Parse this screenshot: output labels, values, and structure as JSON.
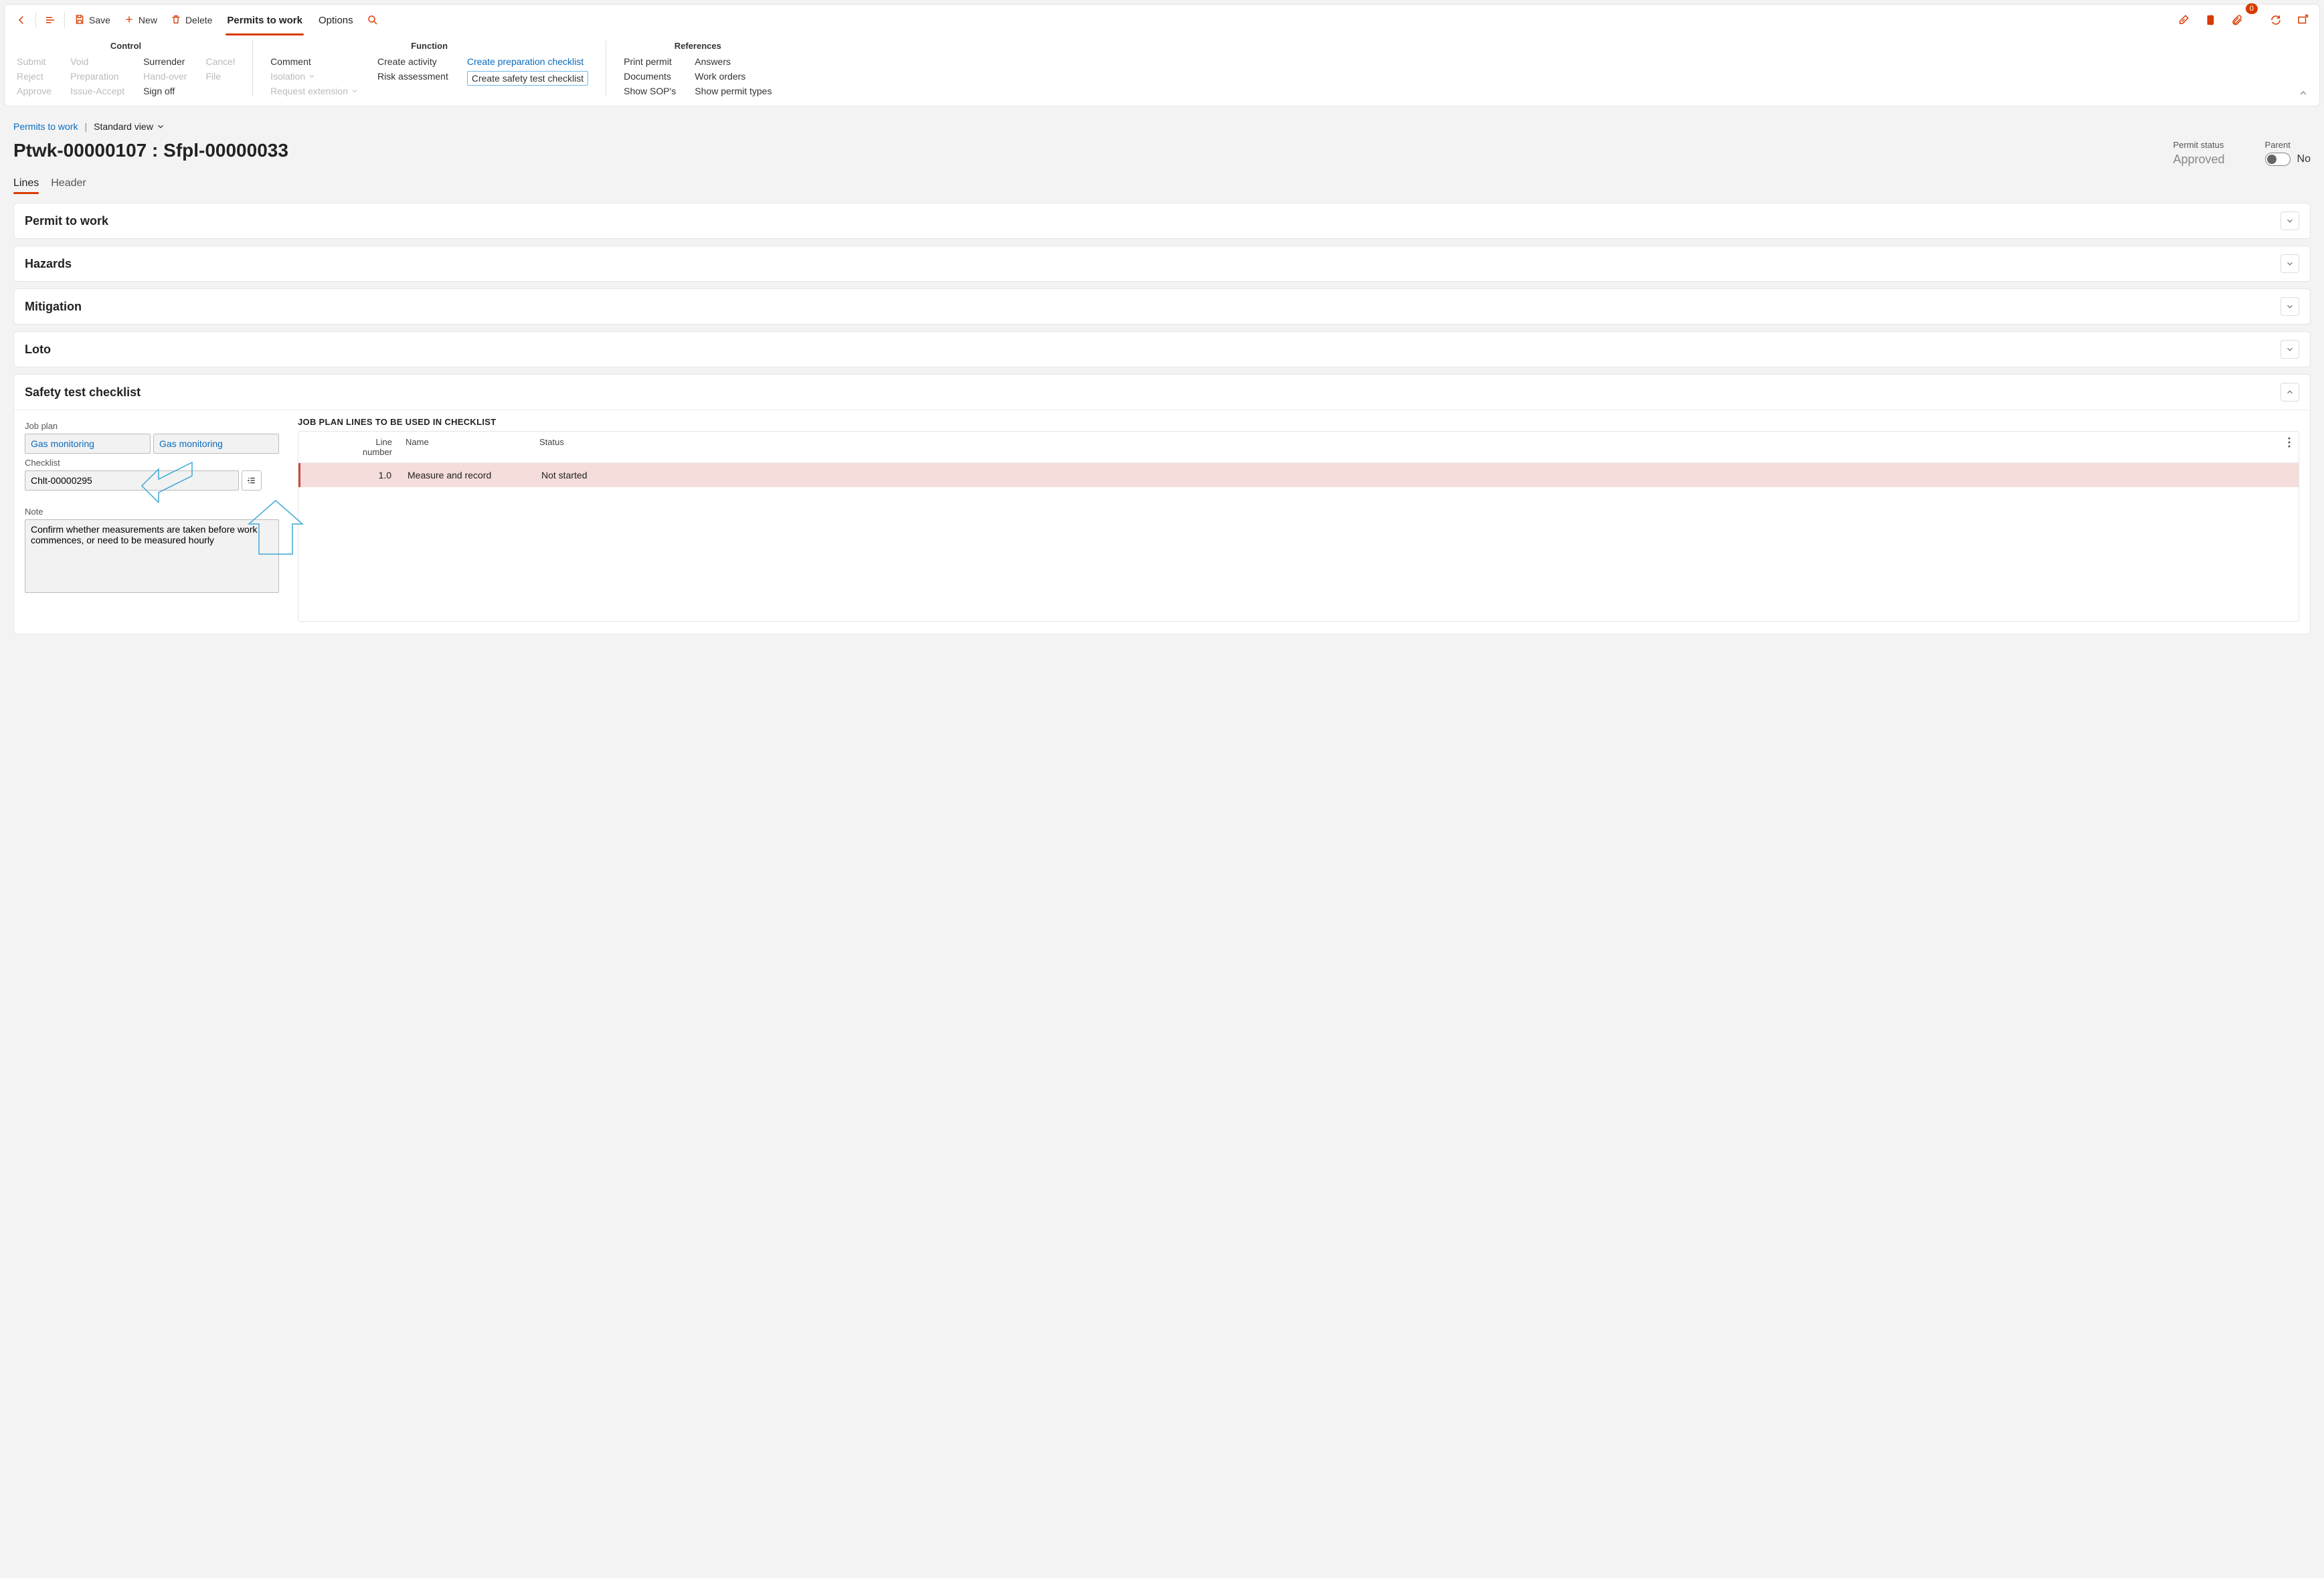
{
  "toolbar": {
    "save": "Save",
    "new": "New",
    "delete": "Delete",
    "tabs": {
      "permits": "Permits to work",
      "options": "Options"
    },
    "attachments_badge": "0"
  },
  "ribbon": {
    "control": {
      "title": "Control",
      "col1": [
        "Submit",
        "Reject",
        "Approve"
      ],
      "col2": [
        "Void",
        "Preparation",
        "Issue-Accept"
      ],
      "col3": [
        "Surrender",
        "Hand-over",
        "Sign off"
      ],
      "col4": [
        "Cancel",
        "File"
      ]
    },
    "function": {
      "title": "Function",
      "col1": [
        "Comment",
        "Isolation",
        "Request extension"
      ],
      "col2": [
        "Create activity",
        "Risk assessment"
      ],
      "col3": [
        "Create preparation checklist",
        "Create safety test checklist"
      ]
    },
    "references": {
      "title": "References",
      "col1": [
        "Print permit",
        "Documents",
        "Show SOP's"
      ],
      "col2": [
        "Answers",
        "Work orders",
        "Show permit types"
      ]
    }
  },
  "breadcrumb": {
    "link": "Permits to work",
    "view": "Standard view"
  },
  "title": "Ptwk-00000107 : Sfpl-00000033",
  "status": {
    "label": "Permit status",
    "value": "Approved"
  },
  "parent": {
    "label": "Parent",
    "value": "No"
  },
  "subtabs": {
    "lines": "Lines",
    "header": "Header"
  },
  "fasttabs": {
    "permit": "Permit to work",
    "hazards": "Hazards",
    "mitigation": "Mitigation",
    "loto": "Loto",
    "safety": "Safety test checklist"
  },
  "safety": {
    "job_plan_label": "Job plan",
    "job_plan_id": "Gas monitoring",
    "job_plan_name": "Gas monitoring",
    "checklist_label": "Checklist",
    "checklist_id": "Chlt-00000295",
    "note_label": "Note",
    "note_value": "Confirm whether measurements are taken before work commences, or need to be measured hourly",
    "grid_title": "JOB PLAN LINES TO BE USED IN CHECKLIST",
    "columns": {
      "line": "Line number",
      "name": "Name",
      "status": "Status"
    },
    "row": {
      "line": "1.0",
      "name": "Measure and record",
      "status": "Not started"
    }
  }
}
